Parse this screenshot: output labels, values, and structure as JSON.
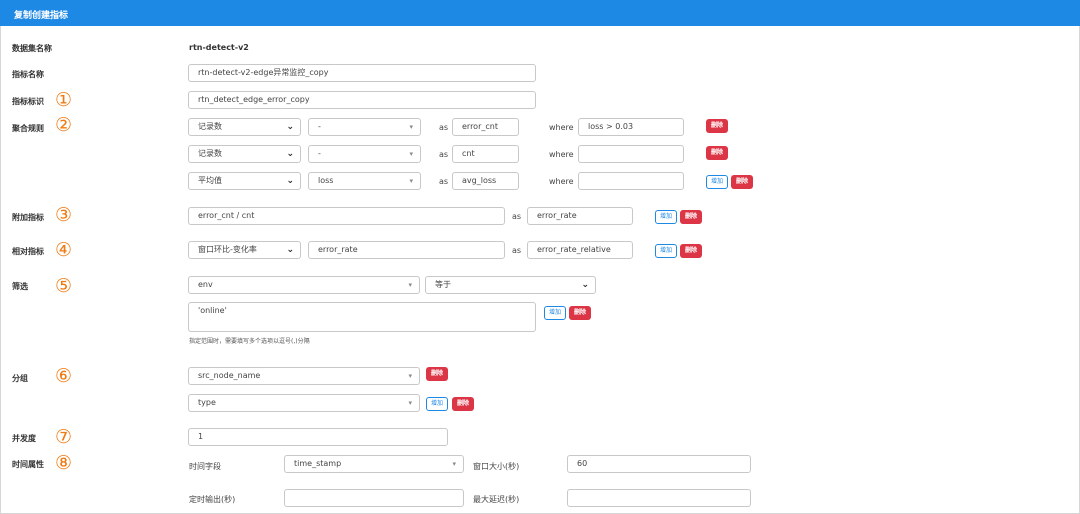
{
  "header": {
    "title": "复制创建指标"
  },
  "dataset": {
    "label": "数据集名称",
    "value": "rtn-detect-v2"
  },
  "metric_name": {
    "label": "指标名称",
    "value": "rtn-detect-v2-edge异常监控_copy"
  },
  "metric_id": {
    "label": "指标标识",
    "value": "rtn_detect_edge_error_copy",
    "badge": "①"
  },
  "aggregation": {
    "label": "聚合规则",
    "badge": "②",
    "rows": [
      {
        "func": "记录数",
        "field": "-",
        "as": "as",
        "alias": "error_cnt",
        "where": "where",
        "cond": "loss > 0.03",
        "del": "删除"
      },
      {
        "func": "记录数",
        "field": "-",
        "as": "as",
        "alias": "cnt",
        "where": "where",
        "cond": "",
        "del": "删除"
      },
      {
        "func": "平均值",
        "field": "loss",
        "as": "as",
        "alias": "avg_loss",
        "where": "where",
        "cond": "",
        "add": "增加",
        "del": "删除"
      }
    ]
  },
  "extra_metric": {
    "label": "附加指标",
    "badge": "③",
    "expr": "error_cnt / cnt",
    "as": "as",
    "alias": "error_rate",
    "add": "增加",
    "del": "删除"
  },
  "relative_metric": {
    "label": "相对指标",
    "badge": "④",
    "type": "窗口环比-变化率",
    "metric": "error_rate",
    "as": "as",
    "alias": "error_rate_relative",
    "add": "增加",
    "del": "删除"
  },
  "filter": {
    "label": "筛选",
    "badge": "⑤",
    "field": "env",
    "op": "等于",
    "value": "'online'",
    "add": "增加",
    "del": "删除",
    "hint": "指定范围时，需要填写多个选项以逗号(,)分隔"
  },
  "group": {
    "label": "分组",
    "badge": "⑥",
    "rows": [
      {
        "field": "src_node_name",
        "del": "删除"
      },
      {
        "field": "type",
        "add": "增加",
        "del": "删除"
      }
    ]
  },
  "concurrency": {
    "label": "并发度",
    "badge": "⑦",
    "value": "1"
  },
  "time_attr": {
    "label": "时间属性",
    "badge": "⑧",
    "time_field_label": "时间字段",
    "time_field": "time_stamp",
    "window_label": "窗口大小(秒)",
    "window": "60",
    "output_label": "定时输出(秒)",
    "output": "",
    "delay_label": "最大延迟(秒)",
    "delay": ""
  }
}
